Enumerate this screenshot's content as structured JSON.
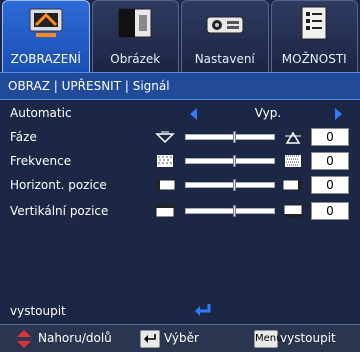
{
  "tabs": [
    {
      "label": "ZOBRAZENÍ",
      "icon": "display-settings-icon",
      "active": true
    },
    {
      "label": "Obrázek",
      "icon": "image-contrast-icon",
      "active": false
    },
    {
      "label": "Nastavení",
      "icon": "projector-icon",
      "active": false
    },
    {
      "label": "MOŽNOSTI",
      "icon": "options-checklist-icon",
      "active": false
    }
  ],
  "breadcrumb": "OBRAZ | UPŘESNIT | Signál",
  "rows": {
    "automatic": {
      "label": "Automatic",
      "value": "Vyp."
    },
    "faze": {
      "label": "Fáze",
      "value": "0",
      "level": 0.55
    },
    "frekvence": {
      "label": "Frekvence",
      "value": "0",
      "level": 0.55
    },
    "horizont": {
      "label": "Horizont. pozice",
      "value": "0",
      "level": 0.55
    },
    "vertikalni": {
      "label": "Vertikální pozice",
      "value": "0",
      "level": 0.55
    }
  },
  "exit_label": "vystoupit",
  "help": {
    "nav": "Nahoru/dolů",
    "select": "Výběr",
    "menu_key": "Menu",
    "exit": "vystoupit"
  },
  "colors": {
    "accent": "#2f7cff",
    "active_tab": "#1b4fb3",
    "crumb": "#214b99",
    "background": "#1c2745",
    "nav_arrow": "#e0323a"
  }
}
